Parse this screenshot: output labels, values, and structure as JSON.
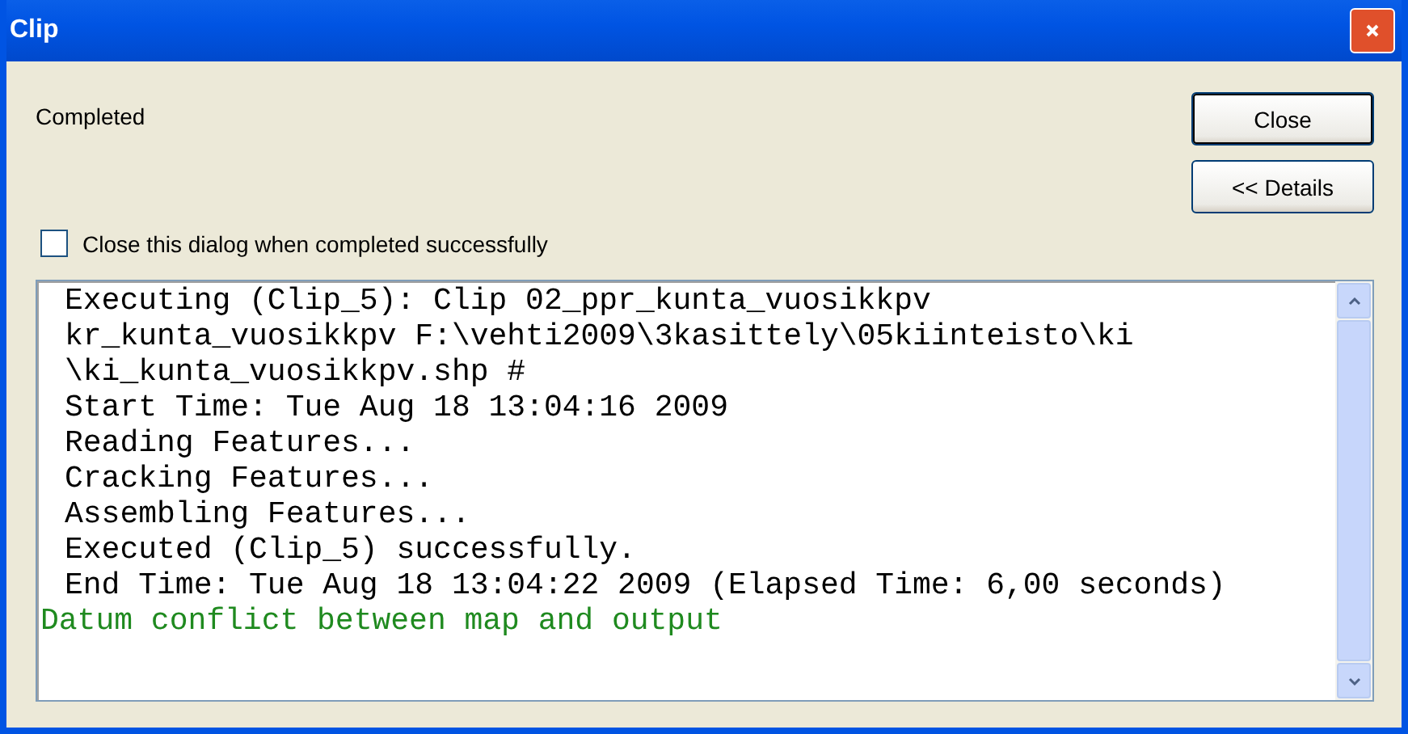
{
  "window": {
    "title": "Clip"
  },
  "status": "Completed",
  "buttons": [
    "Close",
    "<< Details"
  ],
  "checkbox": {
    "label": "Close this dialog when completed successfully",
    "checked": false
  },
  "log": [
    {
      "kind": "message",
      "text": "Executing (Clip_5): Clip 02_ppr_kunta_vuosikkpv"
    },
    {
      "kind": "message",
      "text": "kr_kunta_vuosikkpv F:\\vehti2009\\3kasittely\\05kiinteisto\\ki"
    },
    {
      "kind": "message",
      "text": "\\ki_kunta_vuosikkpv.shp #"
    },
    {
      "kind": "message",
      "text": "Start Time: Tue Aug 18 13:04:16 2009"
    },
    {
      "kind": "message",
      "text": "Reading Features..."
    },
    {
      "kind": "message",
      "text": "Cracking Features..."
    },
    {
      "kind": "message",
      "text": "Assembling Features..."
    },
    {
      "kind": "message",
      "text": "Executed (Clip_5) successfully."
    },
    {
      "kind": "message",
      "text": "End Time: Tue Aug 18 13:04:22 2009 (Elapsed Time: 6,00 seconds)"
    },
    {
      "kind": "warning",
      "text": "Datum conflict between map and output"
    }
  ]
}
